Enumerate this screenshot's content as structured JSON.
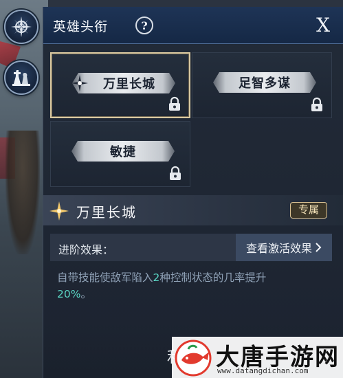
{
  "panel": {
    "title": "英雄头衔",
    "help_symbol": "?",
    "close_symbol": "X"
  },
  "titles": [
    {
      "label": "万里长城",
      "selected": true,
      "locked": true
    },
    {
      "label": "足智多谋",
      "selected": false,
      "locked": true
    },
    {
      "label": "敏捷",
      "selected": false,
      "locked": true
    }
  ],
  "detail": {
    "name": "万里长城",
    "tag": "专属",
    "advance_label": "进阶效果：",
    "view_button": "查看激活效果",
    "desc_prefix": "自带技能使敌军陷入",
    "desc_num": "2",
    "desc_mid": "种控制状态的几率提升",
    "desc_pct": "20%",
    "desc_suffix": "。"
  },
  "bottom_button_partial": "利",
  "watermark": {
    "name": "大唐手游网",
    "url": "www.datangdichan.com"
  },
  "colors": {
    "header_bg": "#152845",
    "highlight": "#5ad6c4",
    "tag_border": "#d9c193",
    "selected_border": "#d9c9a1"
  }
}
